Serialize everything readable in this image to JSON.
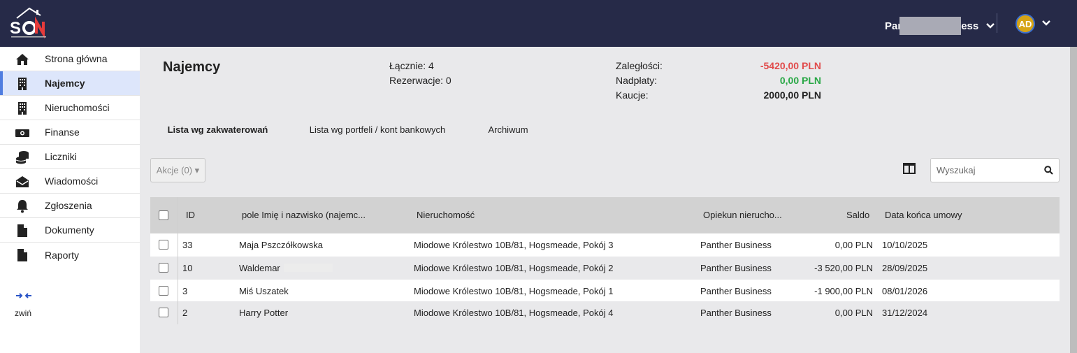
{
  "header": {
    "account_name_start": "Par",
    "account_name_end": "ess",
    "avatar_initials": "AD"
  },
  "sidebar": {
    "items": [
      {
        "label": "Strona główna",
        "icon": "home-icon"
      },
      {
        "label": "Najemcy",
        "icon": "building-icon",
        "active": true
      },
      {
        "label": "Nieruchomości",
        "icon": "building-icon"
      },
      {
        "label": "Finanse",
        "icon": "money-icon"
      },
      {
        "label": "Liczniki",
        "icon": "coins-icon"
      },
      {
        "label": "Wiadomości",
        "icon": "envelope-open-icon"
      },
      {
        "label": "Zgłoszenia",
        "icon": "bell-icon"
      },
      {
        "label": "Dokumenty",
        "icon": "file-icon"
      },
      {
        "label": "Raporty",
        "icon": "file-icon"
      }
    ],
    "collapse_label": "zwiń"
  },
  "page": {
    "title": "Najemcy",
    "total_label": "Łącznie: 4",
    "reservations_label": "Rezerwacje: 0",
    "arrears_label": "Zaległości:",
    "arrears_value": "-5420,00 PLN",
    "overpayments_label": "Nadpłaty:",
    "overpayments_value": "0,00 PLN",
    "deposits_label": "Kaucje:",
    "deposits_value": "2000,00 PLN"
  },
  "colors": {
    "topbar": "#262a48",
    "negative": "#e14b4b",
    "positive": "#27a744",
    "active_nav": "#dde6fb",
    "accent": "#4f7de0"
  },
  "tabs": [
    {
      "label": "Lista wg zakwaterowań",
      "active": true
    },
    {
      "label": "Lista wg portfeli / kont bankowych"
    },
    {
      "label": "Archiwum"
    }
  ],
  "toolbar": {
    "actions_label": "Akcje (0) ▾",
    "search_placeholder": "Wyszukaj"
  },
  "table": {
    "columns": [
      "ID",
      "pole Imię i nazwisko (najemc...",
      "Nieruchomość",
      "Opiekun nierucho...",
      "Saldo",
      "Data końca umowy"
    ],
    "rows": [
      {
        "id": "33",
        "name": "Maja Pszczółkowska",
        "property": "Miodowe Królestwo 10B/81, Hogsmeade, Pokój 3",
        "caretaker": "Panther Business",
        "balance": "0,00 PLN",
        "end_date": "10/10/2025"
      },
      {
        "id": "10",
        "name": "Waldemar",
        "property": "Miodowe Królestwo 10B/81, Hogsmeade, Pokój 2",
        "caretaker": "Panther Business",
        "balance": "-3 520,00 PLN",
        "end_date": "28/09/2025"
      },
      {
        "id": "3",
        "name": "Miś Uszatek",
        "property": "Miodowe Królestwo 10B/81, Hogsmeade, Pokój 1",
        "caretaker": "Panther Business",
        "balance": "-1 900,00 PLN",
        "end_date": "08/01/2026"
      },
      {
        "id": "2",
        "name": "Harry Potter",
        "property": "Miodowe Królestwo 10B/81, Hogsmeade, Pokój 4",
        "caretaker": "Panther Business",
        "balance": "0,00 PLN",
        "end_date": "31/12/2024"
      }
    ]
  }
}
